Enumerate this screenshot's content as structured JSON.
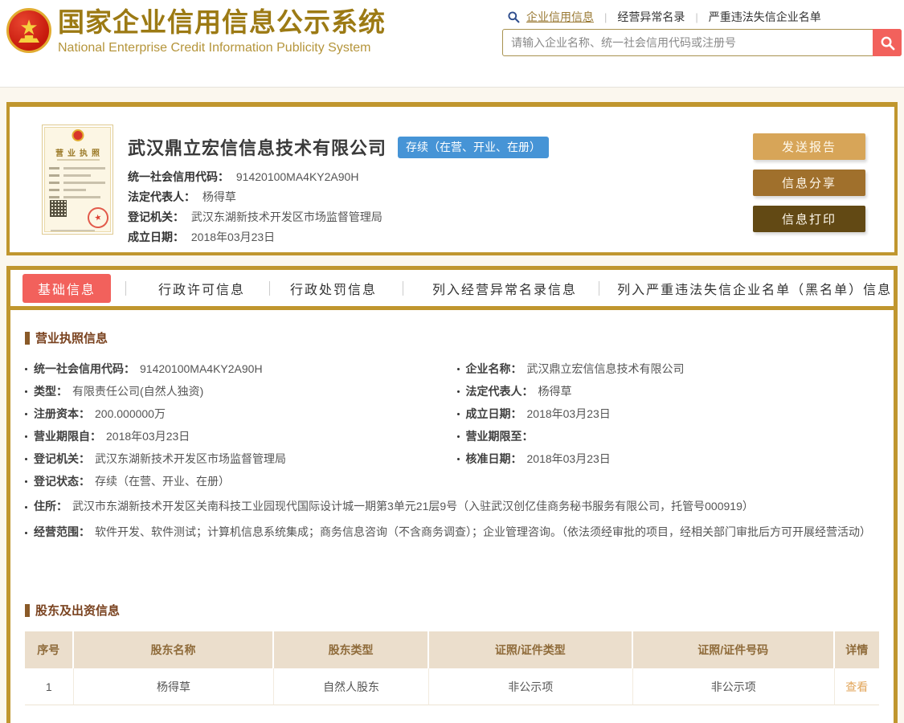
{
  "header": {
    "title": "国家企业信用信息公示系统",
    "subtitle": "National Enterprise Credit Information Publicity System",
    "nav_links": [
      {
        "label": "企业信用信息"
      },
      {
        "label": "经营异常名录"
      },
      {
        "label": "严重违法失信企业名单"
      }
    ],
    "search_placeholder": "请输入企业名称、统一社会信用代码或注册号"
  },
  "company_card": {
    "license_thumb_title": "营业执照",
    "name": "武汉鼎立宏信信息技术有限公司",
    "status_badge": "存续（在营、开业、在册）",
    "fields": [
      {
        "label": "统一社会信用代码：",
        "value": "91420100MA4KY2A90H"
      },
      {
        "label": "法定代表人：",
        "value": "杨得草"
      },
      {
        "label": "登记机关：",
        "value": "武汉东湖新技术开发区市场监督管理局"
      },
      {
        "label": "成立日期：",
        "value": "2018年03月23日"
      }
    ],
    "buttons": [
      {
        "label": "发送报告",
        "color": "#D7A558"
      },
      {
        "label": "信息分享",
        "color": "#A0702C"
      },
      {
        "label": "信息打印",
        "color": "#624914"
      }
    ]
  },
  "tabs": [
    {
      "label": "基础信息",
      "active": true
    },
    {
      "label": "行政许可信息",
      "active": false
    },
    {
      "label": "行政处罚信息",
      "active": false
    },
    {
      "label": "列入经营异常名录信息",
      "active": false
    },
    {
      "label": "列入严重违法失信企业名单（黑名单）信息",
      "active": false
    }
  ],
  "license_section": {
    "title": "营业执照信息",
    "rows": [
      {
        "label": "统一社会信用代码：",
        "value": "91420100MA4KY2A90H"
      },
      {
        "label": "企业名称：",
        "value": "武汉鼎立宏信信息技术有限公司"
      },
      {
        "label": "类型：",
        "value": "有限责任公司(自然人独资)"
      },
      {
        "label": "法定代表人：",
        "value": "杨得草"
      },
      {
        "label": "注册资本：",
        "value": "200.000000万"
      },
      {
        "label": "成立日期：",
        "value": "2018年03月23日"
      },
      {
        "label": "营业期限自：",
        "value": "2018年03月23日"
      },
      {
        "label": "营业期限至：",
        "value": ""
      },
      {
        "label": "登记机关：",
        "value": "武汉东湖新技术开发区市场监督管理局"
      },
      {
        "label": "核准日期：",
        "value": "2018年03月23日"
      },
      {
        "label": "登记状态：",
        "value": "存续（在营、开业、在册）"
      }
    ],
    "full_rows": [
      {
        "label": "住所：",
        "value": "武汉市东湖新技术开发区关南科技工业园现代国际设计城一期第3单元21层9号（入驻武汉创亿佳商务秘书服务有限公司，托管号000919）"
      },
      {
        "label": "经营范围：",
        "value": "软件开发、软件测试；计算机信息系统集成；商务信息咨询（不含商务调查）；企业管理咨询。（依法须经审批的项目，经相关部门审批后方可开展经营活动）"
      }
    ]
  },
  "shareholder_section": {
    "title": "股东及出资信息",
    "table": {
      "headers": [
        "序号",
        "股东名称",
        "股东类型",
        "证照/证件类型",
        "证照/证件号码",
        "详情"
      ],
      "rows": [
        {
          "no": "1",
          "name": "杨得草",
          "type": "自然人股东",
          "cert_type": "非公示项",
          "cert_no": "非公示项",
          "detail": "查看"
        }
      ]
    }
  },
  "colors": {
    "gold_border": "#C0962E",
    "brand_gold": "#9C7A14",
    "accent_red": "#F2615C",
    "status_blue": "#4694D6",
    "section_brown": "#7A4320",
    "table_header_bg": "#EBDECC",
    "link_gold": "#E2A65B"
  }
}
